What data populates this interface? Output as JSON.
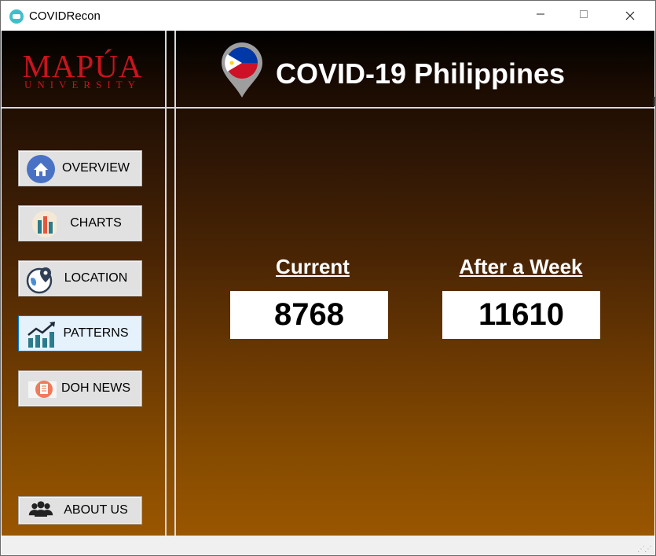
{
  "window": {
    "title": "COVIDRecon"
  },
  "logo": {
    "main": "MAPÚA",
    "sub": "UNIVERSITY"
  },
  "header": {
    "title": "COVID-19 Philippines"
  },
  "nav": {
    "overview": "OVERVIEW",
    "charts": "CHARTS",
    "location": "LOCATION",
    "patterns": "PATTERNS",
    "doh_news": "DOH NEWS",
    "about_us": "ABOUT US",
    "active": "PATTERNS"
  },
  "stats": {
    "current_label": "Current",
    "current_value": "8768",
    "week_label": "After a Week",
    "week_value": "11610"
  },
  "colors": {
    "brand_red": "#c8141e",
    "active_border": "#0078d7",
    "flag_blue": "#0038a8",
    "flag_red": "#ce1126",
    "flag_yellow": "#fcd116"
  }
}
